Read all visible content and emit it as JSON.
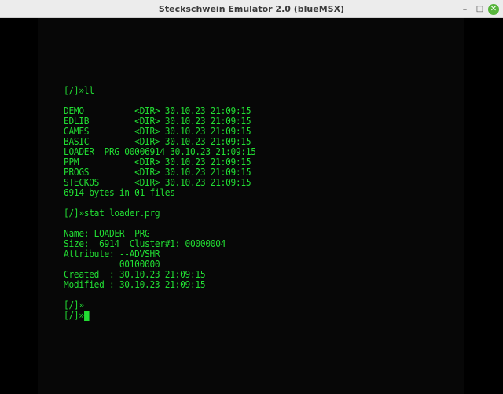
{
  "window": {
    "title": "Steckschwein Emulator 2.0 (blueMSX)",
    "controls": {
      "minimize": "–",
      "maximize": "□",
      "close": "✕"
    }
  },
  "terminal": {
    "text_color": "#22dd33",
    "lines": [
      "[/]»ll",
      "",
      "DEMO          <DIR> 30.10.23 21:09:15",
      "EDLIB         <DIR> 30.10.23 21:09:15",
      "GAMES         <DIR> 30.10.23 21:09:15",
      "BASIC         <DIR> 30.10.23 21:09:15",
      "LOADER  PRG 00006914 30.10.23 21:09:15",
      "PPM           <DIR> 30.10.23 21:09:15",
      "PROGS         <DIR> 30.10.23 21:09:15",
      "STECKOS       <DIR> 30.10.23 21:09:15",
      "6914 bytes in 01 files",
      "",
      "[/]»stat loader.prg",
      "",
      "Name: LOADER  PRG",
      "Size:  6914  Cluster#1: 00000004",
      "Attribute: --ADVSHR",
      "           00100000",
      "Created  : 30.10.23 21:09:15",
      "Modified : 30.10.23 21:09:15",
      "",
      "[/]»",
      "[/]»"
    ]
  }
}
